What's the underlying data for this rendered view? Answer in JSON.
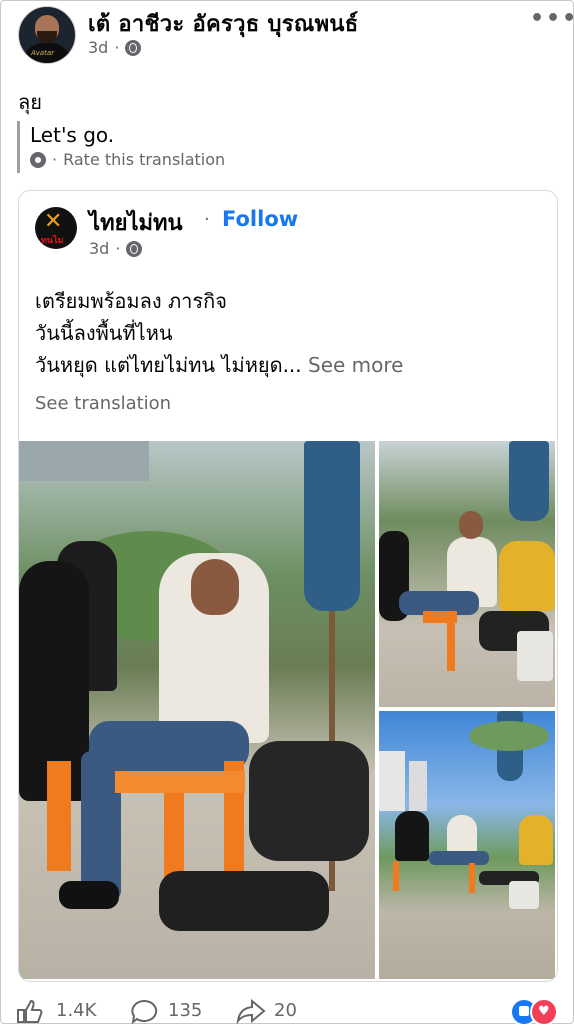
{
  "post": {
    "author": "เต้ อาชีวะ อัครวุธ บุรณพนธ์",
    "time": "3d",
    "more_icon": "more-horizontal-icon",
    "text": "ลุย",
    "translation": "Let's go.",
    "rate_translation": "Rate this translation"
  },
  "shared": {
    "page_name": "ไทยไม่ทน",
    "follow_label": "Follow",
    "separator": "·",
    "time": "3d",
    "lines": [
      "เตรียมพร้อมลง ภารกิจ",
      "วันนี้ลงพื้นที่ไหน",
      "วันหยุด แต่ไทยไม่ทน ไม่หยุด..."
    ],
    "see_more": "See more",
    "see_translation": "See translation"
  },
  "reactions": {
    "likes": "1.4K",
    "comments": "135",
    "shares": "20"
  },
  "colors": {
    "link_blue": "#1877f2",
    "meta_gray": "#65676b"
  }
}
